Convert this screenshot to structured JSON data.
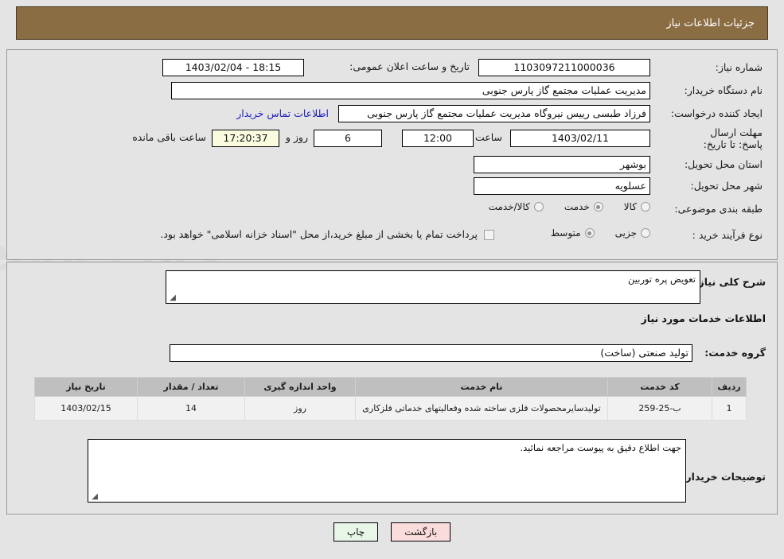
{
  "header": {
    "title": "جزئیات اطلاعات نیاز"
  },
  "colors": {
    "titlebar_bg": "#8b6d43",
    "link": "#2020c0",
    "print_btn_bg": "#e7f6e7",
    "back_btn_bg": "#fbdcdc",
    "countdown_bg": "#fbfbe0",
    "table_header_bg": "#bfbfbf"
  },
  "form": {
    "need_number_label": "شماره نیاز:",
    "need_number_value": "1103097211000036",
    "announce_datetime_label": "تاریخ و ساعت اعلان عمومی:",
    "announce_datetime_value": "18:15 - 1403/02/04",
    "buyer_org_label": "نام دستگاه خریدار:",
    "buyer_org_value": "مدیریت عملیات مجتمع گاز پارس جنوبی",
    "requester_label": "ایجاد کننده درخواست:",
    "requester_value": "فرزاد طبسی رییس نیروگاه مدیریت عملیات مجتمع گاز پارس جنوبی",
    "contact_link": "اطلاعات تماس خریدار",
    "deadline_label": "مهلت ارسال پاسخ: تا تاریخ:",
    "deadline_date": "1403/02/11",
    "deadline_time_label": "ساعت",
    "deadline_time": "12:00",
    "days_remaining": "6",
    "days_unit_label": "روز و",
    "hours_remaining": "17:20:37",
    "hours_unit_label": "ساعت باقی مانده",
    "province_label": "استان محل تحویل:",
    "province_value": "بوشهر",
    "city_label": "شهر محل تحویل:",
    "city_value": "عسلویه",
    "category_label": "طبقه بندی موضوعی:",
    "category_options": [
      {
        "label": "کالا",
        "checked": false
      },
      {
        "label": "خدمت",
        "checked": true
      },
      {
        "label": "کالا/خدمت",
        "checked": false
      }
    ],
    "process_label": "نوع فرآیند خرید :",
    "process_options": [
      {
        "label": "جزیی",
        "checked": false
      },
      {
        "label": "متوسط",
        "checked": true
      }
    ],
    "treasury_checkbox_checked": false,
    "treasury_note": "پرداخت تمام یا بخشی از مبلغ خرید،از محل \"اسناد خزانه اسلامی\" خواهد بود."
  },
  "details": {
    "general_desc_label": "شرح کلی نیاز:",
    "general_desc_value": "تعویض پره توربین",
    "services_heading": "اطلاعات خدمات مورد نیاز",
    "service_group_label": "گروه خدمت:",
    "service_group_value": "تولید صنعتی (ساخت)",
    "buyer_notes_label": "توضیحات خریدار:",
    "buyer_notes_value": "جهت اطلاع دقیق به پیوست مراجعه نمائید."
  },
  "table": {
    "columns": [
      "ردیف",
      "کد خدمت",
      "نام خدمت",
      "واحد اندازه گیری",
      "تعداد / مقدار",
      "تاریخ نیاز"
    ],
    "rows": [
      {
        "index": "1",
        "code": "ب-25-259",
        "name": "تولیدسایرمحصولات فلزی ساخته شده وفعالیتهای خدماتی فلزکاری",
        "unit": "روز",
        "quantity": "14",
        "need_date": "1403/02/15"
      }
    ]
  },
  "footer": {
    "print_label": "چاپ",
    "back_label": "بازگشت"
  }
}
